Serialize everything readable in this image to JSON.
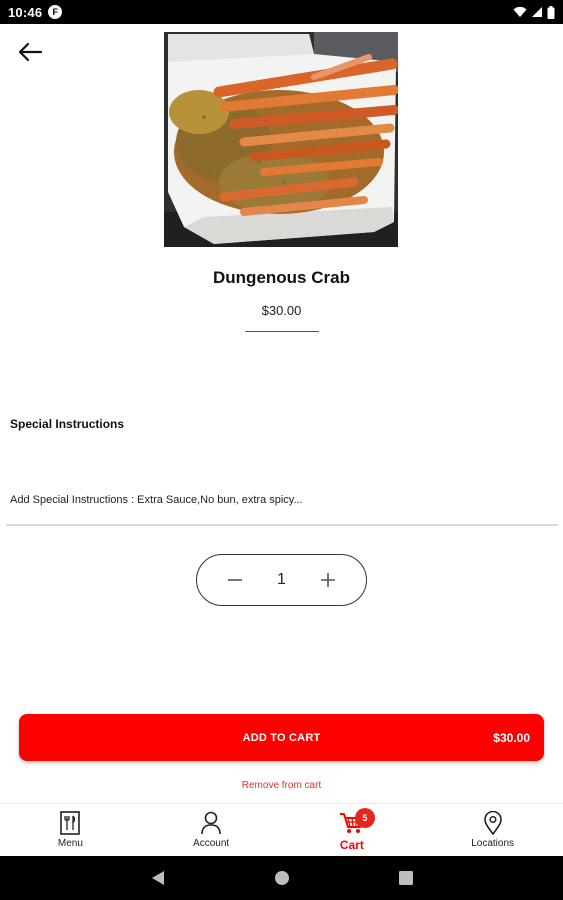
{
  "status_bar": {
    "time": "10:46",
    "app_icon_letter": "F"
  },
  "product": {
    "name": "Dungenous Crab",
    "price": "$30.00"
  },
  "special_instructions": {
    "heading": "Special Instructions",
    "placeholder": "Add Special Instructions : Extra Sauce,No bun, extra spicy..."
  },
  "quantity": {
    "value": "1"
  },
  "add_to_cart": {
    "label": "ADD TO CART",
    "price": "$30.00"
  },
  "remove_link": "Remove from cart",
  "bottom_nav": {
    "menu": "Menu",
    "account": "Account",
    "cart": "Cart",
    "cart_count": "5",
    "locations": "Locations"
  },
  "colors": {
    "accent": "#fe0000",
    "badge": "#e5261f"
  },
  "icons": [
    "back-arrow-icon",
    "minus-icon",
    "plus-icon",
    "menu-icon",
    "account-icon",
    "cart-icon",
    "location-icon",
    "wifi-icon",
    "signal-icon",
    "battery-icon"
  ]
}
